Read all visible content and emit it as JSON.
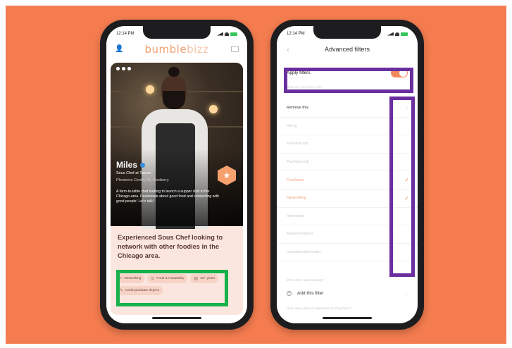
{
  "phone1": {
    "status_time": "12:14 PM",
    "logo_main": "bumble",
    "logo_suffix": "bizz",
    "profile": {
      "name": "Miles",
      "job_title": "Sous Chef at Tavern",
      "location": "Plenmore Centre 25, Roxberry",
      "bio": "A farm-to-table chef looking to launch a supper club in the Chicago-area. Passionate about good food and connecting with good people! Let's talk!",
      "headline": "Experienced Sous Chef looking to network with other foodies in the Chicago area."
    },
    "chips": [
      {
        "icon": "⌕",
        "label": "Networking",
        "icon_name": "search-icon"
      },
      {
        "icon": "⊙",
        "label": "Food & Hospitality",
        "icon_name": "industry-icon"
      },
      {
        "icon": "▤",
        "label": "10+ years",
        "icon_name": "experience-icon"
      },
      {
        "icon": "✎",
        "label": "Undergraduate degree",
        "icon_name": "education-icon"
      }
    ]
  },
  "phone2": {
    "status_time": "12:14 PM",
    "title": "Advanced filters",
    "apply_filters_label": "Apply filters",
    "apply_filters_on": true,
    "subheading": "What are you here to do?",
    "filters": [
      {
        "label": "Remove this",
        "checked": false,
        "style": "dark"
      },
      {
        "label": "Hiring",
        "checked": false,
        "style": "muted"
      },
      {
        "label": "Full-time job",
        "checked": false,
        "style": "muted"
      },
      {
        "label": "Part-time job",
        "checked": false,
        "style": "muted"
      },
      {
        "label": "Freelance",
        "checked": true,
        "style": "accent"
      },
      {
        "label": "Networking",
        "checked": true,
        "style": "accent"
      },
      {
        "label": "Internship",
        "checked": false,
        "style": "muted"
      },
      {
        "label": "Mentee/mentor",
        "checked": false,
        "style": "muted"
      },
      {
        "label": "Investment/investor",
        "checked": false,
        "style": "muted"
      }
    ],
    "question1": "Who's their main industry?",
    "add_filter_label": "Add this filter",
    "question2": "How many years of experience do they have?"
  },
  "colors": {
    "background": "#f47c4f",
    "highlight_green": "#17b14b",
    "highlight_purple": "#6a2e9e",
    "accent": "#f0825a"
  }
}
